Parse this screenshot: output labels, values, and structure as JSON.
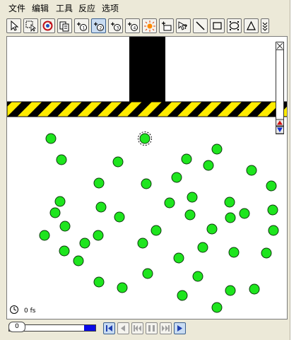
{
  "menubar": {
    "items": [
      "文件",
      "编辑",
      "工具",
      "反应",
      "选项"
    ]
  },
  "toolbar": {
    "tools": [
      {
        "icon": "arrow-select-icon",
        "pressed": false
      },
      {
        "icon": "lasso-select-icon",
        "pressed": false
      },
      {
        "icon": "rotate-icon",
        "pressed": false
      },
      {
        "icon": "duplicate-icon",
        "pressed": false
      },
      {
        "icon": "add-atom-1-icon",
        "pressed": false
      },
      {
        "icon": "add-atom-2-icon",
        "pressed": true
      },
      {
        "icon": "add-atom-3-icon",
        "pressed": false
      },
      {
        "icon": "add-atom-4-icon",
        "pressed": false
      },
      {
        "icon": "heat-icon",
        "pressed": false
      },
      {
        "icon": "add-obstacle-icon",
        "pressed": false
      },
      {
        "icon": "marker-icon",
        "pressed": false
      },
      {
        "icon": "draw-line-icon",
        "pressed": false
      },
      {
        "icon": "draw-rectangle-icon",
        "pressed": false
      },
      {
        "icon": "draw-ellipse-icon",
        "pressed": false
      },
      {
        "icon": "draw-triangle-icon",
        "pressed": false
      },
      {
        "icon": "more-tools-icon",
        "pressed": false
      }
    ]
  },
  "colors": {
    "atom": "#1ee51e",
    "hazard_yellow": "#ffeb00",
    "hazard_black": "#000000",
    "slider_fill": "#0a0ae6"
  },
  "simulation": {
    "time_readout": "0 fs",
    "progress": 0.0
  },
  "slider": {
    "value_label": "0"
  },
  "playback": {
    "buttons": [
      "reset-icon",
      "step-back-icon",
      "rewind-icon",
      "pause-icon",
      "fast-forward-icon",
      "play-icon"
    ]
  }
}
